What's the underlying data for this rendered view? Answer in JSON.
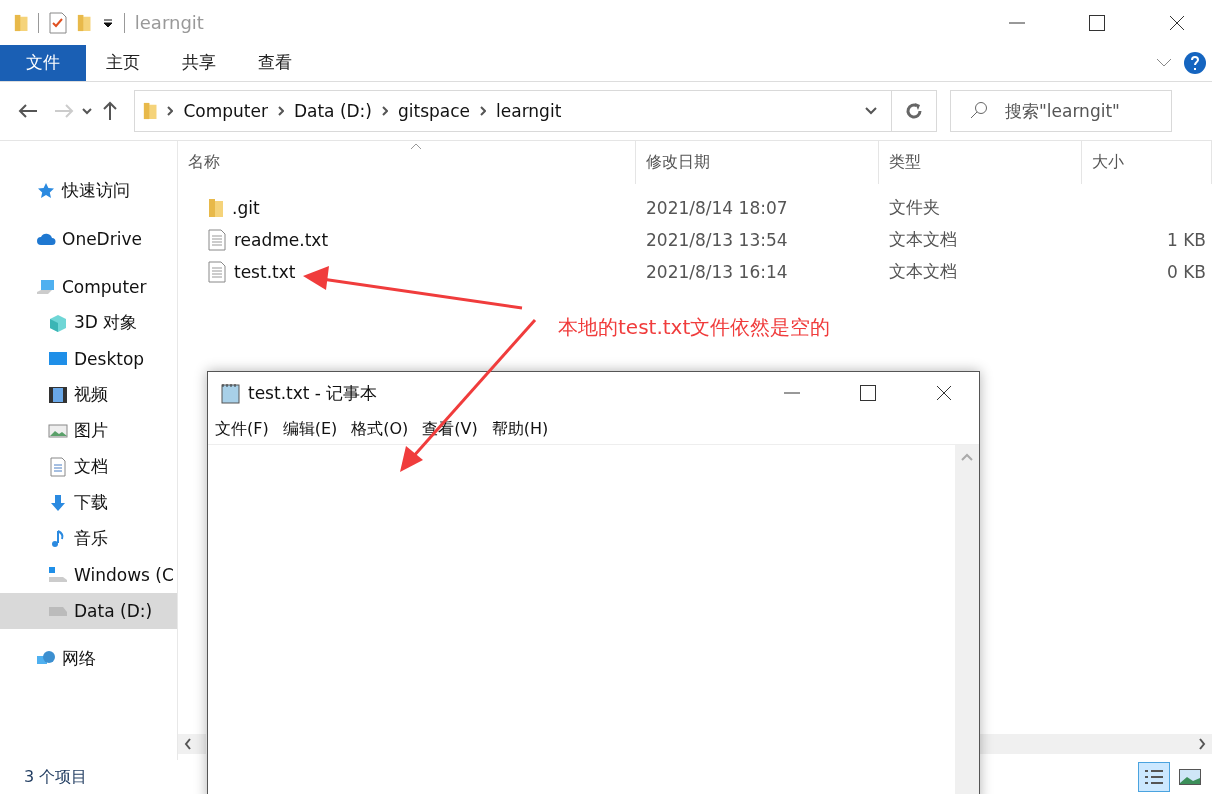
{
  "title_bar": {
    "title": "learngit"
  },
  "ribbon_tabs": [
    {
      "label": "文件",
      "selected": true
    },
    {
      "label": "主页",
      "selected": false
    },
    {
      "label": "共享",
      "selected": false
    },
    {
      "label": "查看",
      "selected": false
    }
  ],
  "address": {
    "path": [
      "Computer",
      "Data (D:)",
      "gitspace",
      "learngit"
    ]
  },
  "search": {
    "placeholder": "搜索\"learngit\""
  },
  "sidebar": {
    "items": [
      {
        "kind": "star",
        "label": "快速访问",
        "selected": false
      },
      {
        "kind": "cloud",
        "label": "OneDrive",
        "selected": false
      },
      {
        "kind": "computer",
        "label": "Computer",
        "selected": false,
        "children": [
          {
            "kind": "cube",
            "label": "3D 对象",
            "selected": false
          },
          {
            "kind": "desktop",
            "label": "Desktop",
            "selected": false
          },
          {
            "kind": "video",
            "label": "视频",
            "selected": false
          },
          {
            "kind": "picture",
            "label": "图片",
            "selected": false
          },
          {
            "kind": "document",
            "label": "文档",
            "selected": false
          },
          {
            "kind": "download",
            "label": "下载",
            "selected": false
          },
          {
            "kind": "music",
            "label": "音乐",
            "selected": false
          },
          {
            "kind": "windrive",
            "label": "Windows (C",
            "selected": false
          },
          {
            "kind": "drive",
            "label": "Data (D:)",
            "selected": true
          }
        ]
      },
      {
        "kind": "network",
        "label": "网络",
        "selected": false
      }
    ]
  },
  "columns": [
    "名称",
    "修改日期",
    "类型",
    "大小"
  ],
  "files": [
    {
      "kind": "folder",
      "name": ".git",
      "modified": "2021/8/14 18:07",
      "type": "文件夹"
    },
    {
      "kind": "file",
      "name": "readme.txt",
      "modified": "2021/8/13 13:54",
      "type": "文本文档",
      "size": "1 KB"
    },
    {
      "kind": "file",
      "name": "test.txt",
      "modified": "2021/8/13 16:14",
      "type": "文本文档",
      "size": "0 KB"
    }
  ],
  "status_bar": {
    "count": "3 个项目",
    "views": [
      {
        "kind": "details",
        "selected": true
      },
      {
        "kind": "thumbnails",
        "selected": false
      }
    ]
  },
  "notepad": {
    "title": "test.txt - 记事本",
    "menu": [
      "文件(F)",
      "编辑(E)",
      "格式(O)",
      "查看(V)",
      "帮助(H)"
    ]
  },
  "annotation": {
    "text": "本地的test.txt文件依然是空的"
  }
}
